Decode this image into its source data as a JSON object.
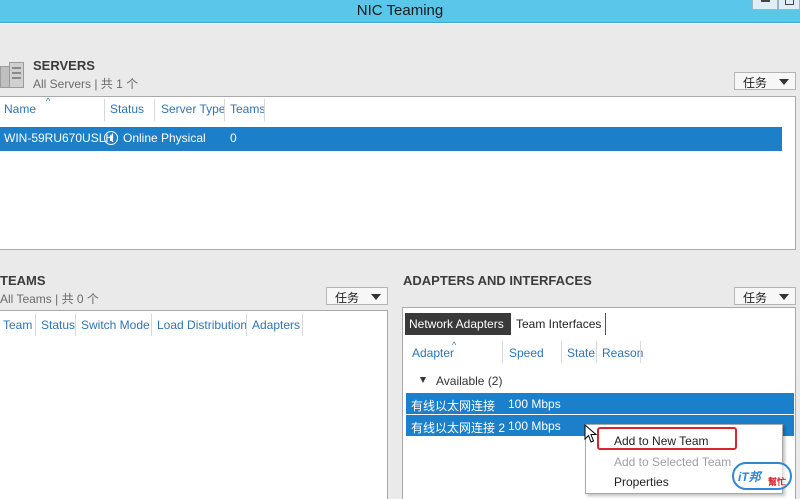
{
  "window": {
    "title": "NIC Teaming"
  },
  "servers": {
    "title": "SERVERS",
    "subtitle": "All Servers | 共 1 个",
    "tasks_label": "任务",
    "columns": [
      "Name",
      "Status",
      "Server Type",
      "Teams"
    ],
    "rows": [
      {
        "name": "WIN-59RU670USLH",
        "status": "Online",
        "server_type": "Physical",
        "teams": "0"
      }
    ]
  },
  "teams": {
    "title": "TEAMS",
    "subtitle": "All Teams | 共 0 个",
    "tasks_label": "任务",
    "columns": [
      "Team",
      "Status",
      "Switch Mode",
      "Load Distribution",
      "Adapters"
    ]
  },
  "adapters": {
    "title": "ADAPTERS AND INTERFACES",
    "tasks_label": "任务",
    "tabs": [
      "Network Adapters",
      "Team Interfaces"
    ],
    "columns": [
      "Adapter",
      "Speed",
      "State",
      "Reason"
    ],
    "group_label": "Available (2)",
    "rows": [
      {
        "adapter": "有线以太网连接",
        "speed": "100 Mbps"
      },
      {
        "adapter": "有线以太网连接 2",
        "speed": "100 Mbps"
      }
    ]
  },
  "context_menu": {
    "items": [
      {
        "label": "Add to New Team",
        "enabled": true
      },
      {
        "label": "Add to Selected Team",
        "enabled": false
      },
      {
        "label": "Properties",
        "enabled": true
      }
    ]
  },
  "watermark": {
    "text": "iT邦",
    "sub": "幫忙"
  },
  "colors": {
    "titlebar": "#59c6ea",
    "selection": "#1c7fc9",
    "header_text": "#2e75b6",
    "highlight": "#d9262c"
  }
}
